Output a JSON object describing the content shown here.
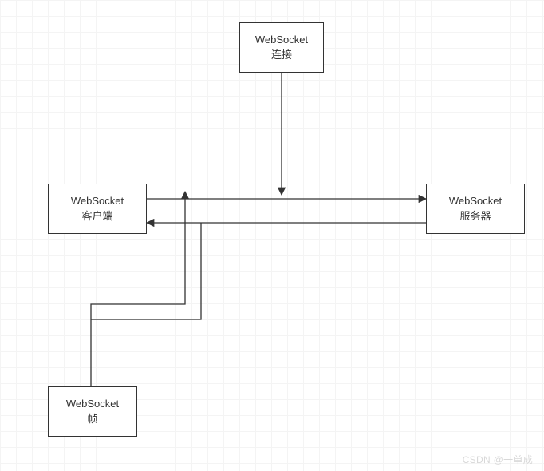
{
  "nodes": {
    "connection": {
      "line1": "WebSocket",
      "line2": "连接"
    },
    "client": {
      "line1": "WebSocket",
      "line2": "客户端"
    },
    "server": {
      "line1": "WebSocket",
      "line2": "服务器"
    },
    "frame": {
      "line1": "WebSocket",
      "line2": "帧"
    }
  },
  "watermark": "CSDN @一单成"
}
